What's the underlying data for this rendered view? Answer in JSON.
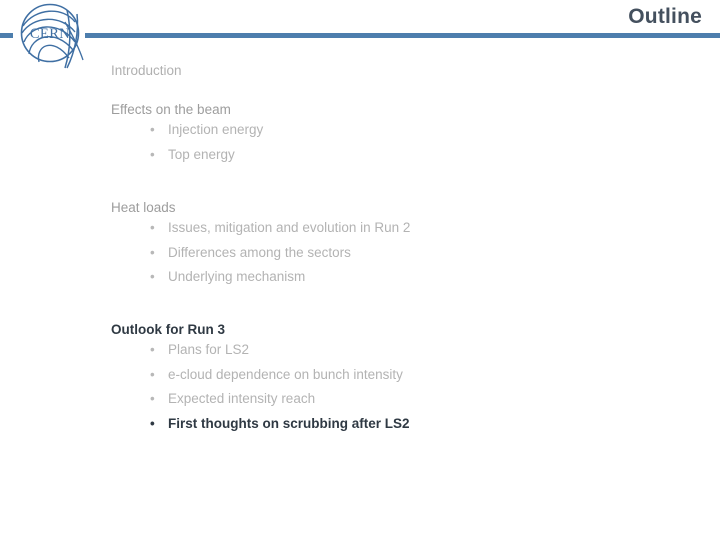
{
  "header": {
    "title": "Outline",
    "logo_name": "CERN",
    "accent_color": "#4d7ead",
    "title_color": "#44505e"
  },
  "content": {
    "sections": [
      {
        "id": "introduction",
        "heading": "Introduction",
        "emphasis": "dim-1",
        "bullets": []
      },
      {
        "id": "effects",
        "heading": "Effects on the beam",
        "emphasis": "dim-2",
        "bullets": [
          {
            "text": "Injection energy",
            "emphasis": "dim"
          },
          {
            "text": "Top energy",
            "emphasis": "dim"
          }
        ]
      },
      {
        "id": "heat",
        "heading": "Heat loads",
        "emphasis": "dim-2",
        "bullets": [
          {
            "text": "Issues, mitigation and evolution in Run 2",
            "emphasis": "dim"
          },
          {
            "text": "Differences among the sectors",
            "emphasis": "dim"
          },
          {
            "text": "Underlying mechanism",
            "emphasis": "dim"
          }
        ]
      },
      {
        "id": "outlook",
        "heading": "Outlook for Run 3",
        "emphasis": "strong",
        "bullets": [
          {
            "text": "Plans for LS2",
            "emphasis": "dim"
          },
          {
            "text": "e-cloud dependence on bunch intensity",
            "emphasis": "dim"
          },
          {
            "text": "Expected intensity reach",
            "emphasis": "dim"
          },
          {
            "text": "First thoughts on scrubbing after LS2",
            "emphasis": "strong"
          }
        ]
      }
    ],
    "bullet_glyph": "•"
  }
}
